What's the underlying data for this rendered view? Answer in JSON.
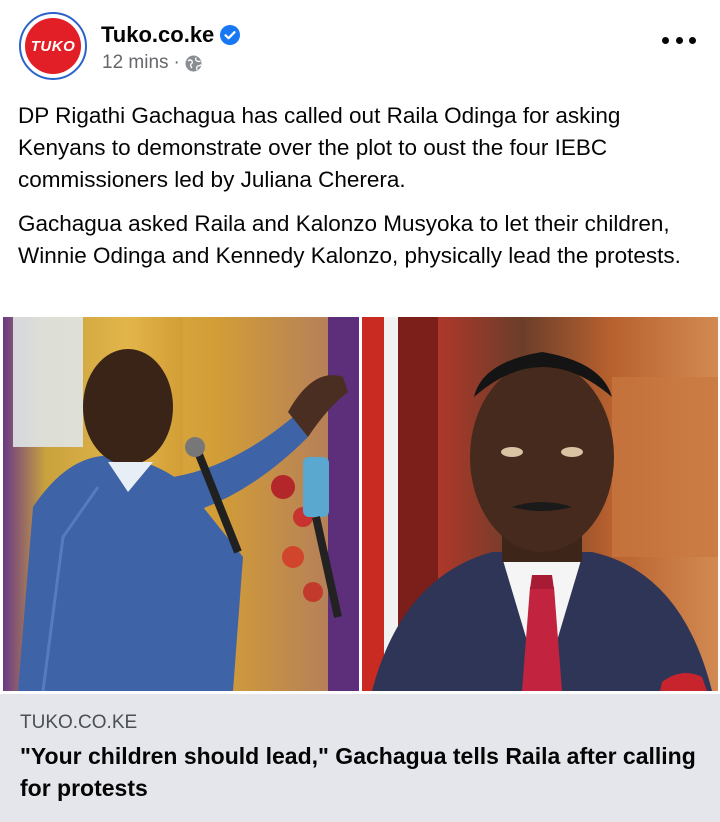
{
  "header": {
    "avatar_text": "TUKO",
    "page_name": "Tuko.co.ke",
    "time": "12 mins",
    "separator": "·",
    "audience_icon": "globe-icon",
    "verified_icon": "verified-badge-icon",
    "more_icon": "more-options-icon"
  },
  "post": {
    "paragraphs": [
      "DP Rigathi Gachagua has called out Raila Odinga for asking Kenyans to demonstrate over the plot to oust the four IEBC commissioners led by Juliana Cherera.",
      "Gachagua asked Raila and Kalonzo Musyoka to let their children, Winnie Odinga and Kennedy Kalonzo, physically lead the protests."
    ]
  },
  "link_preview": {
    "domain": "TUKO.CO.KE",
    "title": "\"Your children should lead,\" Gachagua tells Raila after calling for protests"
  },
  "colors": {
    "brand_red": "#e21e26",
    "verified_blue": "#1877f2",
    "preview_bg": "#e4e6eb",
    "meta_gray": "#65676b"
  }
}
